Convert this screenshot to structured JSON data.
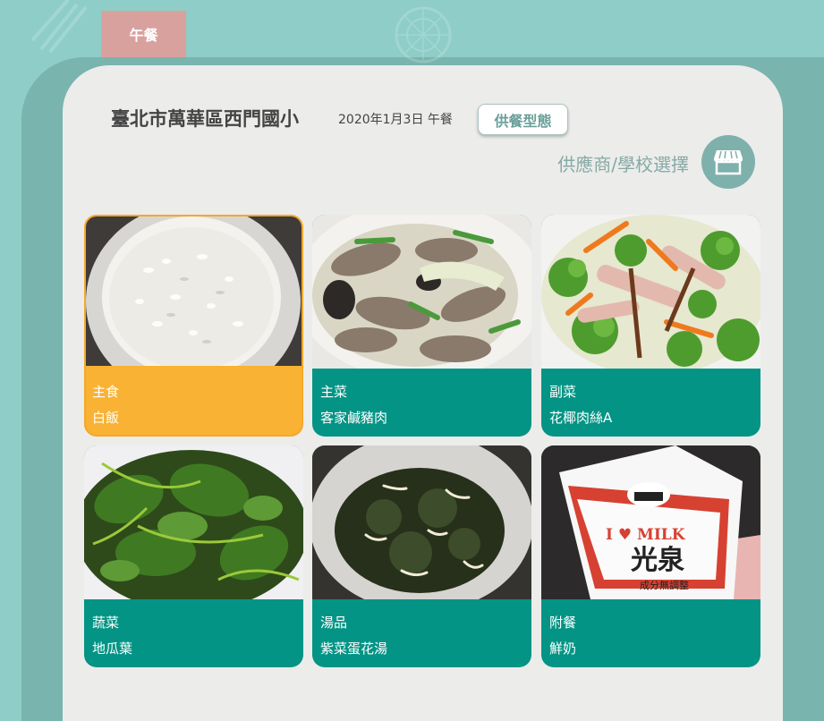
{
  "tab": {
    "label": "午餐"
  },
  "header": {
    "school": "臺北市萬華區西門國小",
    "date": "2020年1月3日 午餐",
    "service_type_button": "供餐型態",
    "supplier_link": "供應商/學校選擇"
  },
  "icons": {
    "store": "store-icon"
  },
  "colors": {
    "teal": "#039485",
    "selected": "#f9b233",
    "tab": "#d9a19e",
    "card": "#ececea"
  },
  "dishes": [
    {
      "category": "主食",
      "name": "白飯",
      "selected": true
    },
    {
      "category": "主菜",
      "name": "客家鹹豬肉",
      "selected": false
    },
    {
      "category": "副菜",
      "name": "花椰肉絲A",
      "selected": false
    },
    {
      "category": "蔬菜",
      "name": "地瓜葉",
      "selected": false
    },
    {
      "category": "湯品",
      "name": "紫菜蛋花湯",
      "selected": false
    },
    {
      "category": "附餐",
      "name": "鮮奶",
      "selected": false
    }
  ],
  "milk_carton": {
    "brand": "I ♥ MILK",
    "name": "光泉",
    "subtitle": "成分無調整"
  }
}
